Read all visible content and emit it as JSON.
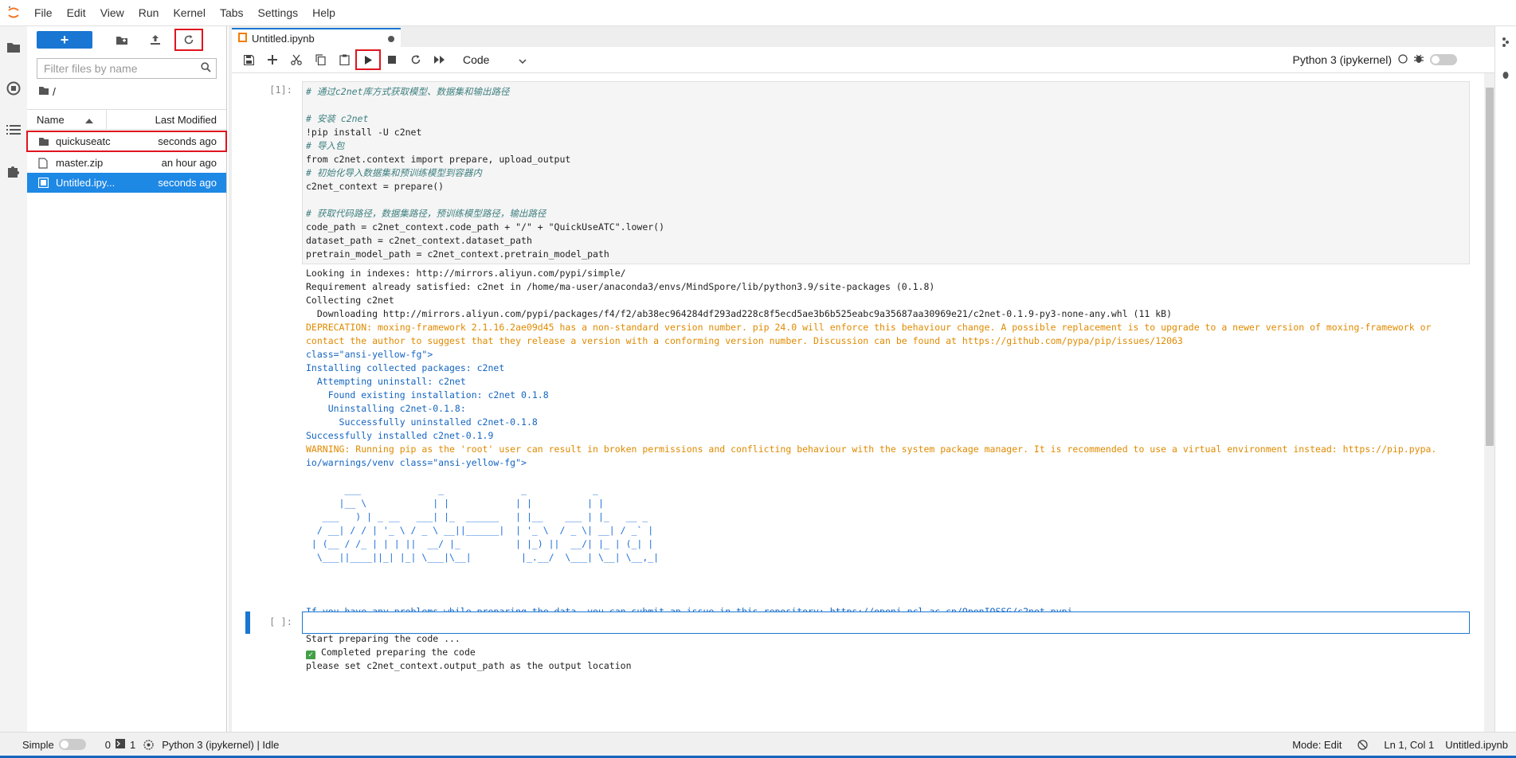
{
  "menubar": {
    "items": [
      "File",
      "Edit",
      "View",
      "Run",
      "Kernel",
      "Tabs",
      "Settings",
      "Help"
    ]
  },
  "filebrowser": {
    "new_label": "+",
    "search_placeholder": "Filter files by name",
    "breadcrumb": "/",
    "col_name": "Name",
    "col_modified": "Last Modified",
    "files": [
      {
        "name": "quickuseatc",
        "modified": "seconds ago",
        "type": "folder"
      },
      {
        "name": "master.zip",
        "modified": "an hour ago",
        "type": "file"
      },
      {
        "name": "Untitled.ipy...",
        "modified": "seconds ago",
        "type": "notebook"
      }
    ]
  },
  "tab": {
    "title": "Untitled.ipynb"
  },
  "notebook_toolbar": {
    "cell_type": "Code",
    "kernel": "Python 3 (ipykernel)"
  },
  "cell1": {
    "prompt": "[1]:",
    "lines": [
      "# 通过c2net库方式获取模型、数据集和输出路径",
      "",
      "# 安装 c2net",
      "!pip install -U c2net",
      "# 导入包",
      "from c2net.context import prepare, upload_output",
      "# 初始化导入数据集和预训练模型到容器内",
      "c2net_context = prepare()",
      "",
      "# 获取代码路径，数据集路径，预训练模型路径，输出路径",
      "code_path = c2net_context.code_path + \"/\" + \"QuickUseATC\".lower()",
      "dataset_path = c2net_context.dataset_path",
      "pretrain_model_path = c2net_context.pretrain_model_path"
    ]
  },
  "output": {
    "lines": [
      "Looking in indexes: http://mirrors.aliyun.com/pypi/simple/",
      "Requirement already satisfied: c2net in /home/ma-user/anaconda3/envs/MindSpore/lib/python3.9/site-packages (0.1.8)",
      "Collecting c2net",
      "  Downloading http://mirrors.aliyun.com/pypi/packages/f4/f2/ab38ec964284df293ad228c8f5ecd5ae3b6b525eabc9a35687aa30969e21/c2net-0.1.9-py3-none-any.whl (11 kB)",
      "DEPRECATION: moxing-framework 2.1.16.2ae09d45 has a non-standard version number. pip 24.0 will enforce this behaviour change. A possible replacement is to upgrade to a newer version of moxing-framework or",
      "contact the author to suggest that they release a version with a conforming version number. Discussion can be found at https://github.com/pypa/pip/issues/12063",
      "class=\"ansi-yellow-fg\">",
      "Installing collected packages: c2net",
      "  Attempting uninstall: c2net",
      "    Found existing installation: c2net 0.1.8",
      "    Uninstalling c2net-0.1.8:",
      "      Successfully uninstalled c2net-0.1.8",
      "Successfully installed c2net-0.1.9",
      "WARNING: Running pip as the 'root' user can result in broken permissions and conflicting behaviour with the system package manager. It is recommended to use a virtual environment instead: https://pip.pypa.",
      "io/warnings/venv class=\"ansi-yellow-fg\">",
      "",
      "       ___              _              _            _",
      "      |__ \\            | |            | |          | |",
      "   ___   ) | _ __   ___| |_  ______   | |__    ___ | |_   __ _",
      "  / __| / / | '_ \\ / _ \\ __||______|  | '_ \\  / _ \\| __| / _` |",
      " | (__ / /_ | | | ||  __/ |_          | |_) ||  __/| |_ | (_| |",
      "  \\___||____||_| |_| \\___|\\__|         |_.__/  \\___| \\__| \\__,_|",
      "",
      "",
      "",
      "If you have any problems while preparing the data, you can submit an issue in this repository: https://openi.pcl.ac.cn/OpenIOSSG/c2net-pypi",
      "",
      "Start preparing the code ...",
      "Completed preparing the code",
      "please set c2net_context.output_path as the output location"
    ]
  },
  "cell2": {
    "prompt": "[ ]:"
  },
  "statusbar": {
    "mode_label": "Simple",
    "count_a": "0",
    "count_b": "1",
    "kernel_status": "Python 3 (ipykernel) | Idle",
    "edit_mode": "Mode: Edit",
    "position": "Ln 1, Col 1",
    "filename": "Untitled.ipynb"
  }
}
